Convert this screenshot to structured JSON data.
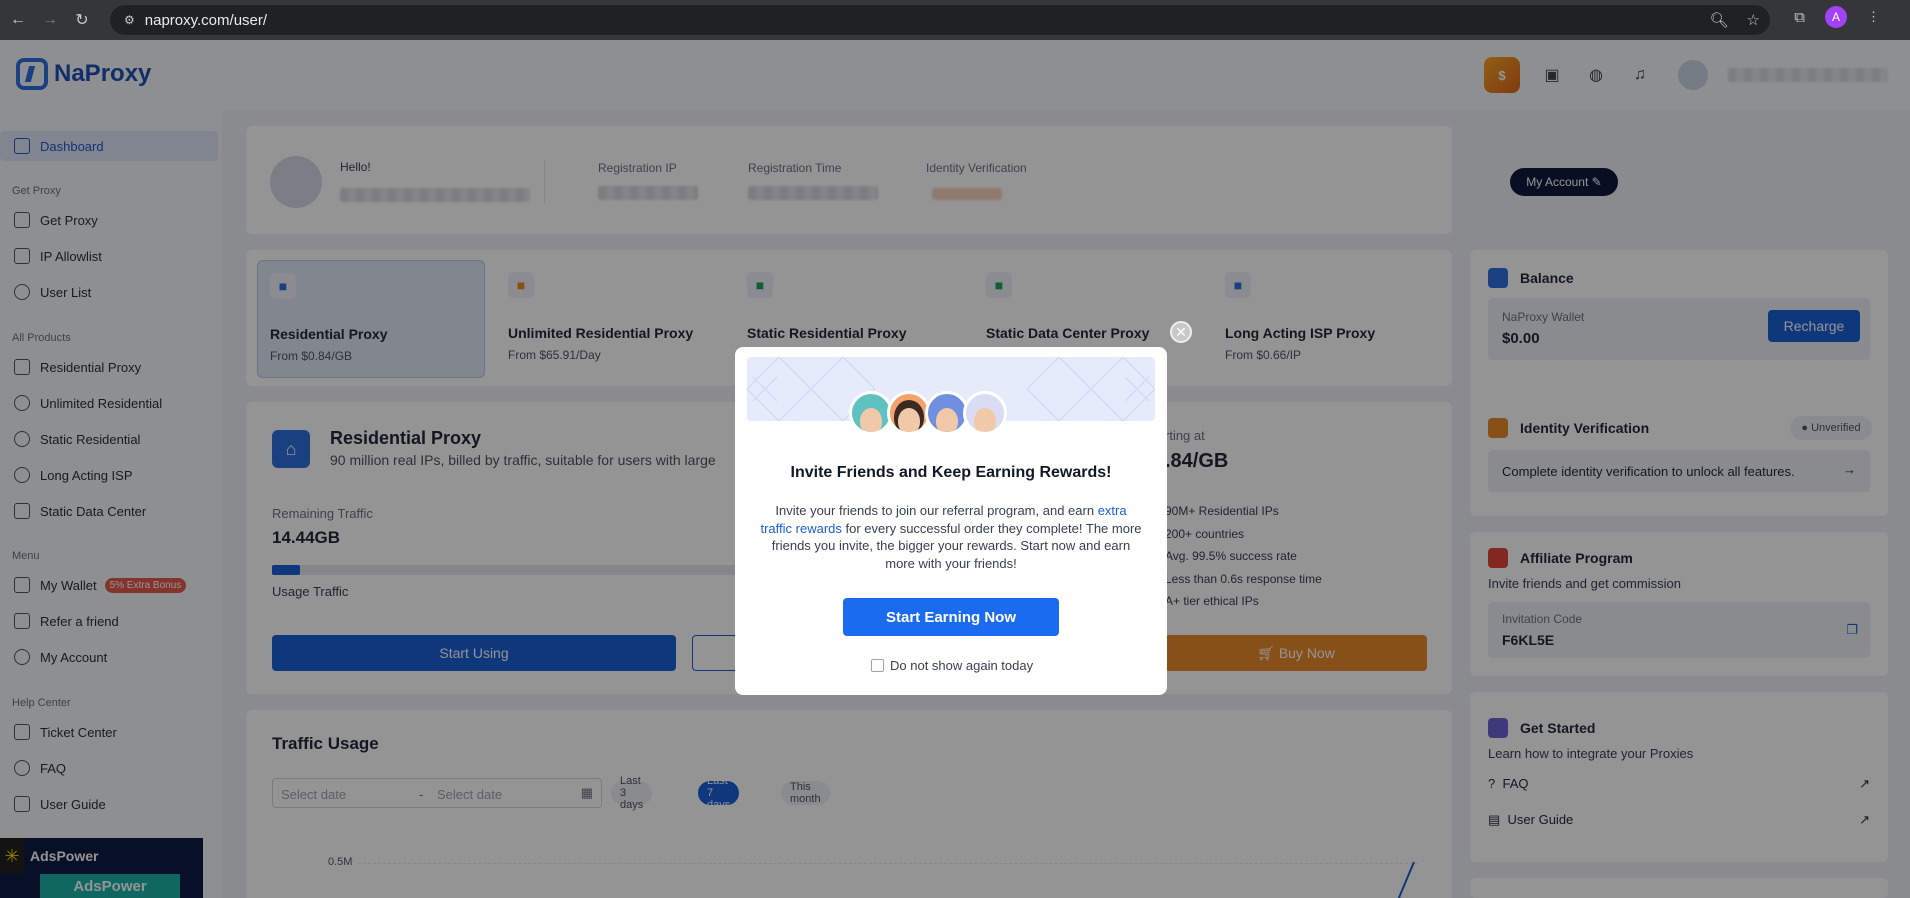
{
  "browser": {
    "url": "naproxy.com/user/",
    "profile_initial": "A"
  },
  "brand": {
    "name": "NaProxy"
  },
  "sidebar": {
    "dashboard": "Dashboard",
    "sections": {
      "get_proxy": "Get Proxy",
      "all_products": "All Products",
      "menu": "Menu",
      "help_center": "Help Center"
    },
    "get_proxy_items": [
      "Get Proxy",
      "IP Allowlist",
      "User List"
    ],
    "product_items": [
      "Residential Proxy",
      "Unlimited Residential",
      "Static Residential",
      "Long Acting ISP",
      "Static Data Center"
    ],
    "menu_items": [
      "My Wallet",
      "Refer a friend",
      "My Account"
    ],
    "wallet_badge": "5% Extra Bonus",
    "help_items": [
      "Ticket Center",
      "FAQ",
      "User Guide"
    ],
    "ad": {
      "title": "AdsPower",
      "subtitle": "AdsPower"
    }
  },
  "profile": {
    "hello": "Hello!",
    "registration_ip_label": "Registration IP",
    "registration_time_label": "Registration Time",
    "identity_label": "Identity Verification",
    "my_account_button": "My Account"
  },
  "products": [
    {
      "name": "Residential Proxy",
      "price": "From $0.84/GB",
      "icon": "house-icon",
      "color": "#2f6fde"
    },
    {
      "name": "Unlimited Residential Proxy",
      "price": "From $65.91/Day",
      "icon": "infinity-icon",
      "color": "#f08a24"
    },
    {
      "name": "Static Residential Proxy",
      "price": "",
      "icon": "shield-bolt-icon",
      "color": "#22a35a"
    },
    {
      "name": "Static Data Center Proxy",
      "price": "",
      "icon": "server-icon",
      "color": "#22a35a"
    },
    {
      "name": "Long Acting ISP Proxy",
      "price": "From $0.66/IP",
      "icon": "nodes-icon",
      "color": "#2f6fde"
    }
  ],
  "plan": {
    "title": "Residential Proxy",
    "desc": "90 million real IPs, billed by traffic, suitable for users with large",
    "remaining_label": "Remaining Traffic",
    "remaining_value": "14.44GB",
    "usage_label": "Usage Traffic",
    "usage_fraction": 0.06,
    "start_button": "Start Using",
    "starting_label": "rting at",
    "price_value": ".84/GB",
    "features": [
      "90M+ Residential IPs",
      "200+ countries",
      "Avg. 99.5% success rate",
      "Less than 0.6s response time",
      "A+ tier ethical IPs"
    ],
    "buy_button": "Buy Now"
  },
  "traffic": {
    "title": "Traffic Usage",
    "start_placeholder": "Select date",
    "separator": "-",
    "end_placeholder": "Select date",
    "ranges": [
      "Last 3 days",
      "Last 7 days",
      "This month"
    ],
    "active_range": "Last 7 days",
    "y_tick": "0.5M"
  },
  "right": {
    "balance_title": "Balance",
    "wallet_label": "NaProxy Wallet",
    "wallet_value": "$0.00",
    "recharge_button": "Recharge",
    "identity_title": "Identity Verification",
    "identity_status": "Unverified",
    "identity_text": "Complete identity verification to unlock all features.",
    "affiliate_title": "Affiliate Program",
    "affiliate_sub": "Invite friends and get commission",
    "invite_label": "Invitation Code",
    "invite_code": "F6KL5E",
    "started_title": "Get Started",
    "started_sub": "Learn how to integrate your Proxies",
    "links": [
      "FAQ",
      "User Guide"
    ]
  },
  "modal": {
    "title": "Invite Friends and Keep Earning Rewards!",
    "body_1": "Invite your friends to join our referral program, and earn",
    "body_link": "extra traffic rewards",
    "body_2": "for every successful order they complete! The more friends you invite, the bigger your rewards. Start now and earn more with your friends!",
    "cta": "Start Earning Now",
    "checkbox": "Do not show again today"
  },
  "colors": {
    "primary": "#1a5fd6",
    "orange": "#e98b2a",
    "dark": "#0f1b3d"
  }
}
